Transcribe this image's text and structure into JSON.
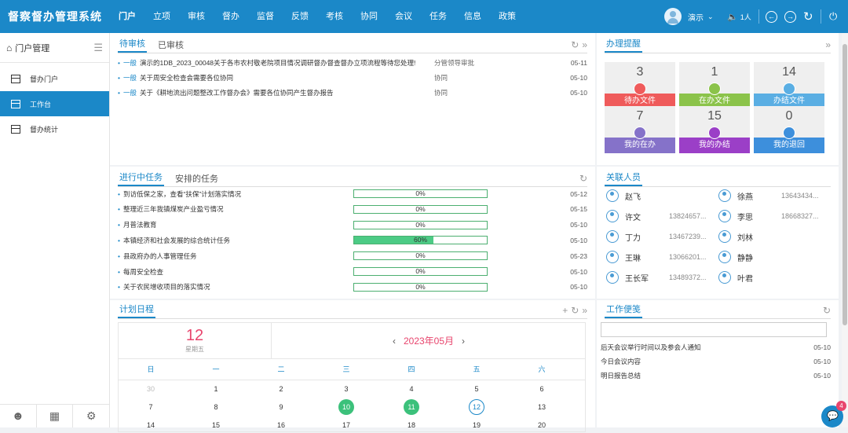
{
  "app": {
    "title": "督察督办管理系统"
  },
  "nav": {
    "items": [
      {
        "label": "门户",
        "active": true
      },
      {
        "label": "立项"
      },
      {
        "label": "审核"
      },
      {
        "label": "督办"
      },
      {
        "label": "监督"
      },
      {
        "label": "反馈"
      },
      {
        "label": "考核"
      },
      {
        "label": "协同"
      },
      {
        "label": "会议"
      },
      {
        "label": "任务"
      },
      {
        "label": "信息"
      },
      {
        "label": "政策"
      }
    ]
  },
  "user": {
    "name": "演示",
    "online": "1人"
  },
  "sidebar": {
    "title": "门户管理",
    "items": [
      {
        "label": "督办门户"
      },
      {
        "label": "工作台",
        "active": true
      },
      {
        "label": "督办统计"
      }
    ]
  },
  "pending": {
    "tabs": [
      "待审核",
      "已审核"
    ],
    "rows": [
      {
        "tag": "一般",
        "title": "演示的1DB_2023_00048关于各市农村敬老院项目情况调研督办督查督办立项流程等待您处理!",
        "step": "分管领导审批",
        "date": "05-11"
      },
      {
        "tag": "一般",
        "title": "关于周安全检查会需要各位协同",
        "step": "协同",
        "date": "05-10"
      },
      {
        "tag": "一般",
        "title": "关于《耕地流出问题整改工作督办会》需要各位协同产生督办报告",
        "step": "协同",
        "date": "05-10"
      }
    ]
  },
  "reminders": {
    "title": "办理提醒",
    "cards": [
      {
        "num": "3",
        "label": "待办文件",
        "color": "#ef5b5b"
      },
      {
        "num": "1",
        "label": "在办文件",
        "color": "#8bc34a"
      },
      {
        "num": "14",
        "label": "办结文件",
        "color": "#5aaee3"
      },
      {
        "num": "7",
        "label": "我的在办",
        "color": "#8572c9"
      },
      {
        "num": "15",
        "label": "我的办结",
        "color": "#9b3fc7"
      },
      {
        "num": "0",
        "label": "我的退回",
        "color": "#3d8fdc"
      }
    ]
  },
  "tasks": {
    "tabs": [
      "进行中任务",
      "安排的任务"
    ],
    "rows": [
      {
        "title": "到访低保之家，查看“扶保”计划落实情况",
        "progress": 0,
        "progress_label": "0%",
        "date": "05-12"
      },
      {
        "title": "整理近三年我镇煤炭产业盈亏情况",
        "progress": 0,
        "progress_label": "0%",
        "date": "05-15"
      },
      {
        "title": "月普法教育",
        "progress": 0,
        "progress_label": "0%",
        "date": "05-10"
      },
      {
        "title": "本镇经济和社会发展的综合统计任务",
        "progress": 60,
        "progress_label": "60%",
        "date": "05-10"
      },
      {
        "title": "县政府办的人事管理任务",
        "progress": 0,
        "progress_label": "0%",
        "date": "05-23"
      },
      {
        "title": "每周安全检查",
        "progress": 0,
        "progress_label": "0%",
        "date": "05-10"
      },
      {
        "title": "关于农民增收项目的落实情况",
        "progress": 0,
        "progress_label": "0%",
        "date": "05-10"
      }
    ]
  },
  "contacts": {
    "title": "关联人员",
    "people": [
      {
        "name": "赵飞",
        "phone": ""
      },
      {
        "name": "徐燕",
        "phone": "13643434..."
      },
      {
        "name": "许文",
        "phone": "13824657..."
      },
      {
        "name": "李思",
        "phone": "18668327..."
      },
      {
        "name": "丁力",
        "phone": "13467239..."
      },
      {
        "name": "刘林",
        "phone": ""
      },
      {
        "name": "王琳",
        "phone": "13066201..."
      },
      {
        "name": "静静",
        "phone": ""
      },
      {
        "name": "王长军",
        "phone": "13489372..."
      },
      {
        "name": "叶君",
        "phone": ""
      }
    ]
  },
  "calendar": {
    "title": "计划日程",
    "day": "12",
    "weekday": "星期五",
    "month_label": "2023年05月",
    "weekdays": [
      "日",
      "一",
      "二",
      "三",
      "四",
      "五",
      "六"
    ],
    "weeks": [
      [
        "30",
        "1",
        "2",
        "3",
        "4",
        "5",
        "6"
      ],
      [
        "7",
        "8",
        "9",
        "10",
        "11",
        "12",
        "13"
      ],
      [
        "14",
        "15",
        "16",
        "17",
        "18",
        "19",
        "20"
      ]
    ]
  },
  "notes": {
    "title": "工作便笺",
    "input_placeholder": "",
    "items": [
      {
        "text": "后天会议举行时间以及参会人通知",
        "date": "05-10"
      },
      {
        "text": "今日会议内容",
        "date": "05-10"
      },
      {
        "text": "明日报告总结",
        "date": "05-10"
      }
    ]
  },
  "chat": {
    "badge": "4"
  }
}
